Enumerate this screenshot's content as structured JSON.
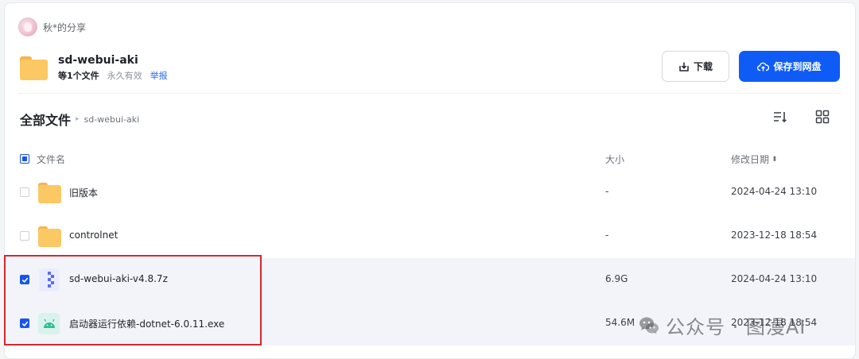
{
  "sharer": {
    "name": "秋*的分享",
    "avatar": "avatar"
  },
  "share": {
    "title": "sd-webui-aki",
    "file_count": "等1个文件",
    "validity": "永久有效",
    "report_label": "举报",
    "folder_icon": "folder-icon"
  },
  "actions": {
    "download_label": "下载",
    "download_icon": "download-icon",
    "save_label": "保存到网盘",
    "save_icon": "cloud-upload-icon",
    "accent_color": "#0f5bf5"
  },
  "breadcrumb": {
    "root": "全部文件",
    "separator": "▸",
    "current": "sd-webui-aki"
  },
  "view_controls": {
    "sort_icon": "sort-list-icon",
    "grid_icon": "grid-view-icon"
  },
  "table": {
    "columns": {
      "name": "文件名",
      "size": "大小",
      "date": "修改日期",
      "sort_glyph": "⬍"
    },
    "rows": [
      {
        "name": "旧版本",
        "size": "-",
        "date": "2024-04-24 13:10",
        "type": "folder",
        "icon": "folder-icon",
        "checked": false
      },
      {
        "name": "controlnet",
        "size": "-",
        "date": "2023-12-18 18:54",
        "type": "folder",
        "icon": "folder-icon",
        "checked": false
      },
      {
        "name": "sd-webui-aki-v4.8.7z",
        "size": "6.9G",
        "date": "2024-04-24 13:10",
        "type": "archive",
        "icon": "zip-archive-icon",
        "checked": true
      },
      {
        "name": "启动器运行依赖-dotnet-6.0.11.exe",
        "size": "54.6M",
        "date": "2023-12-18 18:54",
        "type": "exe",
        "icon": "android-app-icon",
        "checked": true
      }
    ]
  },
  "watermark": {
    "text": "公众号 · 图漫AI",
    "icon": "wechat-icon"
  },
  "colors": {
    "highlight_border": "#d7262f",
    "checkbox_checked": "#1655f0",
    "selected_row_bg": "#f2f4fa"
  }
}
